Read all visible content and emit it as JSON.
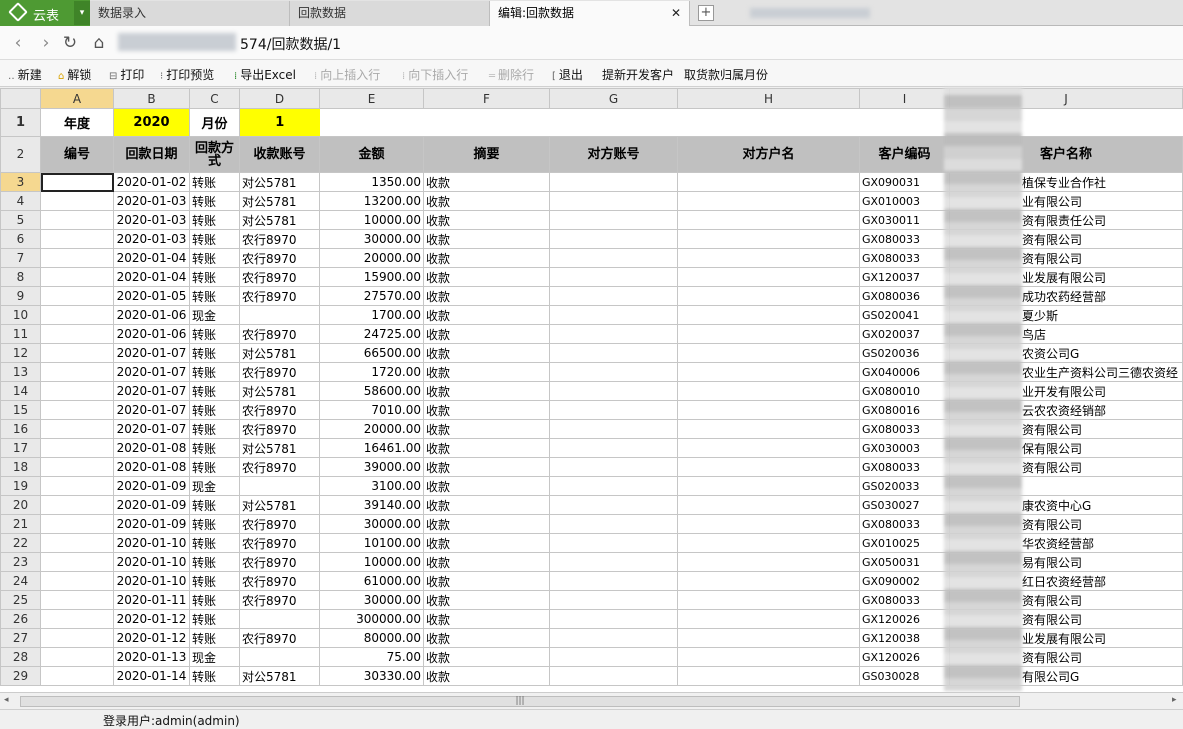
{
  "brand": {
    "name": "云表",
    "caret": "▾"
  },
  "tabs": [
    {
      "label": "数据录入"
    },
    {
      "label": "回款数据"
    },
    {
      "label": "编辑:回款数据",
      "close": "✕"
    }
  ],
  "new_tab_label": "+",
  "address": {
    "back": "‹",
    "forward": "›",
    "refresh": "↻",
    "home": "⌂",
    "url": "574/回款数据/1"
  },
  "toolbar": [
    {
      "label": "新建",
      "icon": "new-icon",
      "enabled": true
    },
    {
      "label": "解锁",
      "icon": "unlock-icon",
      "enabled": true
    },
    {
      "label": "打印",
      "icon": "print-icon",
      "enabled": true
    },
    {
      "label": "打印预览",
      "icon": "print-preview-icon",
      "enabled": true
    },
    {
      "label": "导出Excel",
      "icon": "excel-icon",
      "enabled": true
    },
    {
      "label": "向上插入行",
      "icon": "insert-row-above-icon",
      "enabled": false
    },
    {
      "label": "向下插入行",
      "icon": "insert-row-below-icon",
      "enabled": false
    },
    {
      "label": "删除行",
      "icon": "delete-row-icon",
      "enabled": false
    },
    {
      "label": "退出",
      "icon": "exit-icon",
      "enabled": true
    },
    {
      "label": "提新开发客户",
      "icon": "",
      "enabled": true
    },
    {
      "label": "取货款归属月份",
      "icon": "",
      "enabled": true
    }
  ],
  "columns": [
    "A",
    "B",
    "C",
    "D",
    "E",
    "F",
    "G",
    "H",
    "I",
    "J"
  ],
  "row1": {
    "year_label": "年度",
    "year": "2020",
    "month_label": "月份",
    "month": "1"
  },
  "headers": [
    "编号",
    "回款日期",
    "回款方式",
    "收款账号",
    "金额",
    "摘要",
    "对方账号",
    "对方户名",
    "客户编码",
    "客户名称"
  ],
  "rows": [
    {
      "n": "3",
      "a": "",
      "b": "2020-01-02",
      "c": "转账",
      "d": "对公5781",
      "e": "1350.00",
      "f": "收款",
      "i": "GX090031",
      "j": "植保专业合作社"
    },
    {
      "n": "4",
      "a": "",
      "b": "2020-01-03",
      "c": "转账",
      "d": "对公5781",
      "e": "13200.00",
      "f": "收款",
      "i": "GX010003",
      "j": "业有限公司"
    },
    {
      "n": "5",
      "a": "",
      "b": "2020-01-03",
      "c": "转账",
      "d": "对公5781",
      "e": "10000.00",
      "f": "收款",
      "i": "GX030011",
      "j": "资有限责任公司"
    },
    {
      "n": "6",
      "a": "",
      "b": "2020-01-03",
      "c": "转账",
      "d": "农行8970",
      "e": "30000.00",
      "f": "收款",
      "i": "GX080033",
      "j": "资有限公司"
    },
    {
      "n": "7",
      "a": "",
      "b": "2020-01-04",
      "c": "转账",
      "d": "农行8970",
      "e": "20000.00",
      "f": "收款",
      "i": "GX080033",
      "j": "资有限公司"
    },
    {
      "n": "8",
      "a": "",
      "b": "2020-01-04",
      "c": "转账",
      "d": "农行8970",
      "e": "15900.00",
      "f": "收款",
      "i": "GX120037",
      "j": "业发展有限公司"
    },
    {
      "n": "9",
      "a": "",
      "b": "2020-01-05",
      "c": "转账",
      "d": "农行8970",
      "e": "27570.00",
      "f": "收款",
      "i": "GX080036",
      "j": "成功农药经营部"
    },
    {
      "n": "10",
      "a": "",
      "b": "2020-01-06",
      "c": "现金",
      "d": "",
      "e": "1700.00",
      "f": "收款",
      "i": "GS020041",
      "j": "夏少斯"
    },
    {
      "n": "11",
      "a": "",
      "b": "2020-01-06",
      "c": "转账",
      "d": "农行8970",
      "e": "24725.00",
      "f": "收款",
      "i": "GX020037",
      "j": "鸟店"
    },
    {
      "n": "12",
      "a": "",
      "b": "2020-01-07",
      "c": "转账",
      "d": "对公5781",
      "e": "66500.00",
      "f": "收款",
      "i": "GS020036",
      "j": "农资公司G"
    },
    {
      "n": "13",
      "a": "",
      "b": "2020-01-07",
      "c": "转账",
      "d": "农行8970",
      "e": "1720.00",
      "f": "收款",
      "i": "GX040006",
      "j": "农业生产资料公司三德农资经"
    },
    {
      "n": "14",
      "a": "",
      "b": "2020-01-07",
      "c": "转账",
      "d": "对公5781",
      "e": "58600.00",
      "f": "收款",
      "i": "GX080010",
      "j": "业开发有限公司"
    },
    {
      "n": "15",
      "a": "",
      "b": "2020-01-07",
      "c": "转账",
      "d": "农行8970",
      "e": "7010.00",
      "f": "收款",
      "i": "GX080016",
      "j": "云农农资经销部"
    },
    {
      "n": "16",
      "a": "",
      "b": "2020-01-07",
      "c": "转账",
      "d": "农行8970",
      "e": "20000.00",
      "f": "收款",
      "i": "GX080033",
      "j": "资有限公司"
    },
    {
      "n": "17",
      "a": "",
      "b": "2020-01-08",
      "c": "转账",
      "d": "对公5781",
      "e": "16461.00",
      "f": "收款",
      "i": "GX030003",
      "j": "保有限公司"
    },
    {
      "n": "18",
      "a": "",
      "b": "2020-01-08",
      "c": "转账",
      "d": "农行8970",
      "e": "39000.00",
      "f": "收款",
      "i": "GX080033",
      "j": "资有限公司"
    },
    {
      "n": "19",
      "a": "",
      "b": "2020-01-09",
      "c": "现金",
      "d": "",
      "e": "3100.00",
      "f": "收款",
      "i": "GS020033",
      "j": ""
    },
    {
      "n": "20",
      "a": "",
      "b": "2020-01-09",
      "c": "转账",
      "d": "对公5781",
      "e": "39140.00",
      "f": "收款",
      "i": "GS030027",
      "j": "康农资中心G"
    },
    {
      "n": "21",
      "a": "",
      "b": "2020-01-09",
      "c": "转账",
      "d": "农行8970",
      "e": "30000.00",
      "f": "收款",
      "i": "GX080033",
      "j": "资有限公司"
    },
    {
      "n": "22",
      "a": "",
      "b": "2020-01-10",
      "c": "转账",
      "d": "农行8970",
      "e": "10100.00",
      "f": "收款",
      "i": "GX010025",
      "j": "华农资经营部"
    },
    {
      "n": "23",
      "a": "",
      "b": "2020-01-10",
      "c": "转账",
      "d": "农行8970",
      "e": "10000.00",
      "f": "收款",
      "i": "GX050031",
      "j": "易有限公司"
    },
    {
      "n": "24",
      "a": "",
      "b": "2020-01-10",
      "c": "转账",
      "d": "农行8970",
      "e": "61000.00",
      "f": "收款",
      "i": "GX090002",
      "j": "红日农资经营部"
    },
    {
      "n": "25",
      "a": "",
      "b": "2020-01-11",
      "c": "转账",
      "d": "农行8970",
      "e": "30000.00",
      "f": "收款",
      "i": "GX080033",
      "j": "资有限公司"
    },
    {
      "n": "26",
      "a": "",
      "b": "2020-01-12",
      "c": "转账",
      "d": "",
      "e": "300000.00",
      "f": "收款",
      "i": "GX120026",
      "j": "资有限公司"
    },
    {
      "n": "27",
      "a": "",
      "b": "2020-01-12",
      "c": "转账",
      "d": "农行8970",
      "e": "80000.00",
      "f": "收款",
      "i": "GX120038",
      "j": "业发展有限公司"
    },
    {
      "n": "28",
      "a": "",
      "b": "2020-01-13",
      "c": "现金",
      "d": "",
      "e": "75.00",
      "f": "收款",
      "i": "GX120026",
      "j": "资有限公司"
    },
    {
      "n": "29",
      "a": "",
      "b": "2020-01-14",
      "c": "转账",
      "d": "对公5781",
      "e": "30330.00",
      "f": "收款",
      "i": "GS030028",
      "j": "有限公司G"
    }
  ],
  "scroll": {
    "left": "◂",
    "right": "▸",
    "grip": "|||"
  },
  "status": {
    "user": "登录用户:admin(admin)"
  }
}
